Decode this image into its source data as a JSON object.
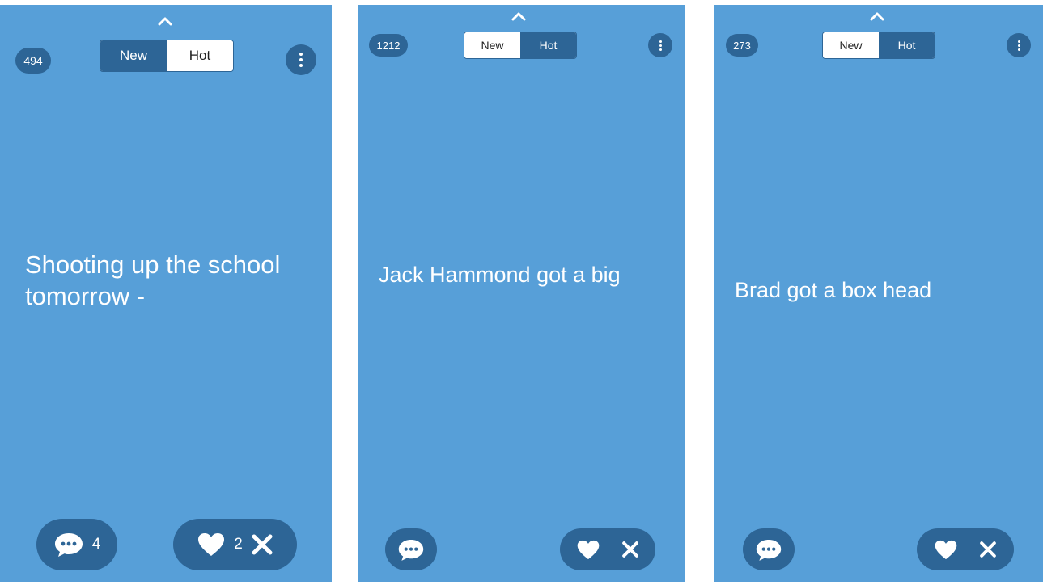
{
  "colors": {
    "background": "#579fd8",
    "accent": "#2d6596",
    "text": "#ffffff"
  },
  "icons": {
    "top": "chevron-up-icon",
    "menu": "more-vertical-icon",
    "comment": "speech-bubble-icon",
    "like": "heart-icon",
    "dismiss": "close-icon"
  },
  "screens": [
    {
      "count": "494",
      "tabs": [
        {
          "label": "New",
          "active": true
        },
        {
          "label": "Hot",
          "active": false
        }
      ],
      "post_text": "Shooting up the school tomorrow -",
      "comment_count": "4",
      "like_count": "2"
    },
    {
      "count": "1212",
      "tabs": [
        {
          "label": "New",
          "active": false
        },
        {
          "label": "Hot",
          "active": true
        }
      ],
      "post_text": "Jack Hammond got a big",
      "comment_count": "",
      "like_count": ""
    },
    {
      "count": "273",
      "tabs": [
        {
          "label": "New",
          "active": false
        },
        {
          "label": "Hot",
          "active": true
        }
      ],
      "post_text": "Brad got a box head",
      "comment_count": "",
      "like_count": ""
    }
  ]
}
